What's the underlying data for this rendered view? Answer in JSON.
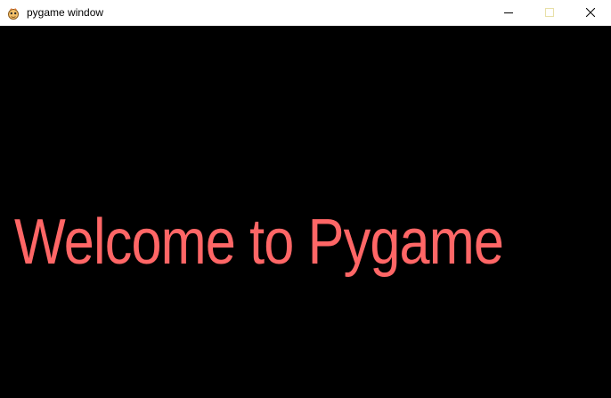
{
  "window": {
    "title": "pygame window"
  },
  "icons": {
    "app": "pygame-snake-icon",
    "minimize": "minimize-icon",
    "maximize": "maximize-icon",
    "close": "close-icon"
  },
  "colors": {
    "titlebar_bg": "#ffffff",
    "surface_bg": "#000000",
    "text": "#ff6666"
  },
  "game": {
    "message": "Welcome to Pygame"
  }
}
